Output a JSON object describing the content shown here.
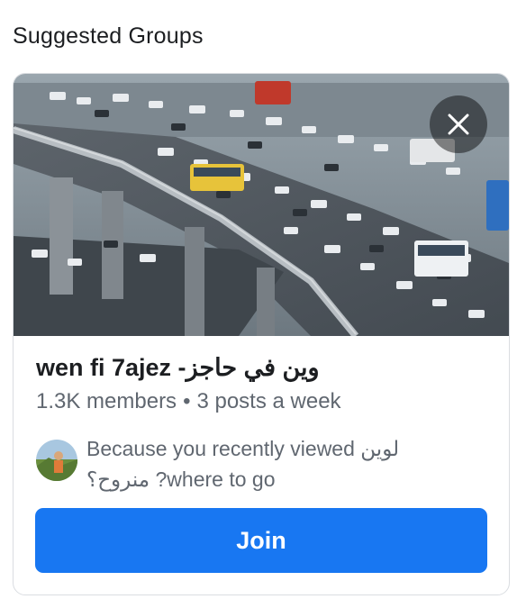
{
  "section": {
    "title": "Suggested Groups"
  },
  "card": {
    "cover_alt": "traffic jam on elevated highway",
    "close_icon": "close-icon",
    "group_name": "wen fi 7ajez -وين في حاجز",
    "members": "1.3K members",
    "separator": "•",
    "activity": "3 posts a week",
    "reason_line1": "Because you recently viewed لوين",
    "reason_line2": "منروح؟ ?where to go",
    "join_label": "Join"
  },
  "colors": {
    "accent": "#1877f2",
    "text_primary": "#1c1e21",
    "text_secondary": "#606770",
    "card_border": "#dadde1"
  }
}
